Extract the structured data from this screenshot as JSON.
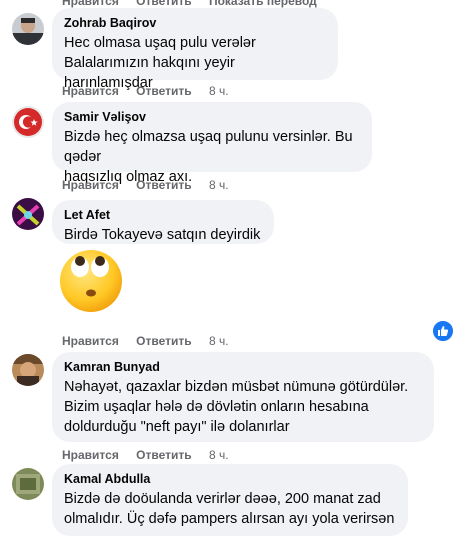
{
  "top_actions": {
    "like": "Нравится",
    "reply": "Ответить",
    "translate": "Показать перевод"
  },
  "comments": [
    {
      "author": "Zohrab Baqirov",
      "text": "Hec olmasa uşaq pulu verələr\nBalalarımızın hakqını yeyir harınlamışdar",
      "like": "Нравится",
      "reply": "Ответить",
      "time": "8 ч."
    },
    {
      "author": "Samir Vəlişov",
      "text": "Bizdə heç olmazsa uşaq pulunu versinlər. Bu qədər\nhaqsızlıq olmaz axı.",
      "like": "Нравится",
      "reply": "Ответить",
      "time": "8 ч."
    },
    {
      "author": "Let Afet",
      "text": "Birdə Tokayevə satqın deyirdik",
      "like": "Нравится",
      "reply": "Ответить",
      "time": "8 ч."
    },
    {
      "author": "Kamran Bunyad",
      "text": "Nəhayət, qazaxlar bizdən müsbət nümunə götürdülər.\nBizim uşaqlar hələ də dövlətin onların hesabına\ndoldurduğu \"neft payı\" ilə dolanırlar",
      "like": "Нравится",
      "reply": "Ответить",
      "time": "8 ч."
    },
    {
      "author": "Kamal Abdulla",
      "text": "Bizdə də doöulanda verirlər dəəə, 200 manat zad\nolmalıdır. Üç dəfə pampers alırsan ayı yola verirsən",
      "like": "Нравится",
      "reply": "Ответить",
      "time": "8 ч."
    }
  ],
  "icons": {
    "emoji": "face-with-rolling-eyes-emoji",
    "reaction": "like-icon"
  },
  "colors": {
    "bubble": "#f0f2f5",
    "meta": "#65676b",
    "like_blue": "#1877f2"
  }
}
